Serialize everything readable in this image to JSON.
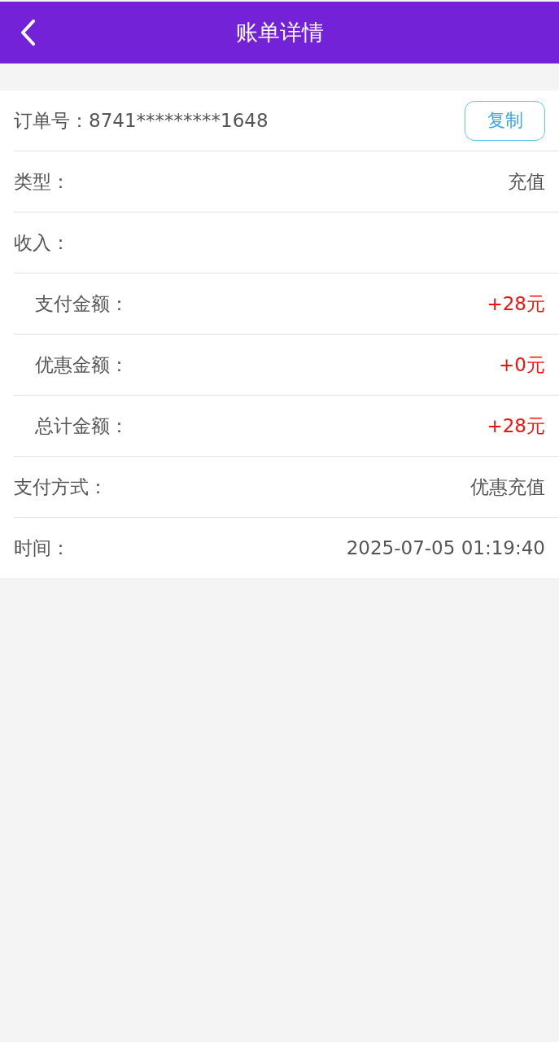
{
  "header": {
    "title": "账单详情"
  },
  "rows": [
    {
      "label": "订单号：",
      "value": "8741*********1648",
      "kind": "order",
      "button": "复制"
    },
    {
      "label": "类型：",
      "value": "充值",
      "kind": "text"
    },
    {
      "label": "收入：",
      "kind": "group",
      "children": [
        {
          "label": "支付金额：",
          "value": "+28元",
          "kind": "amount"
        },
        {
          "label": "优惠金额：",
          "value": "+0元",
          "kind": "amount"
        },
        {
          "label": "总计金额：",
          "value": "+28元",
          "kind": "amount"
        }
      ]
    },
    {
      "label": "支付方式：",
      "value": "优惠充值",
      "kind": "text"
    },
    {
      "label": "时间：",
      "value": "2025-07-05 01:19:40",
      "kind": "text"
    }
  ]
}
